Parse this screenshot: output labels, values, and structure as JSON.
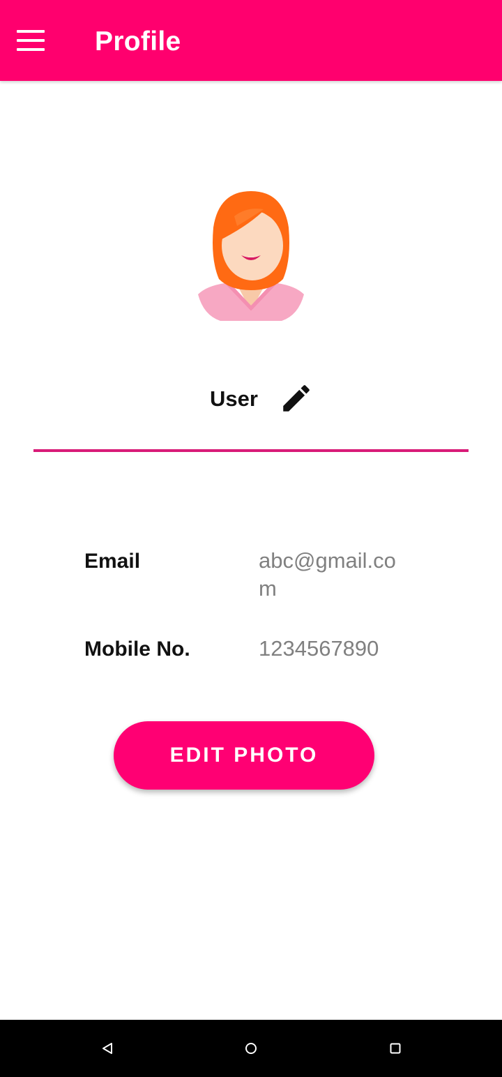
{
  "app_bar": {
    "title": "Profile",
    "color": "#ff006e",
    "menu_icon": "hamburger-menu-icon"
  },
  "profile": {
    "avatar": "female-user-avatar",
    "name": "User",
    "edit_icon": "pencil-icon",
    "underline_color": "#d81b78"
  },
  "info": [
    {
      "label": "Email",
      "value": "abc@gmail.com"
    },
    {
      "label": "Mobile No.",
      "value": "1234567890"
    }
  ],
  "edit_photo_button": {
    "label": "EDIT PHOTO",
    "color": "#ff0073"
  },
  "system_nav": {
    "back_icon": "triangle-back-icon",
    "home_icon": "circle-home-icon",
    "recents_icon": "square-recents-icon"
  }
}
